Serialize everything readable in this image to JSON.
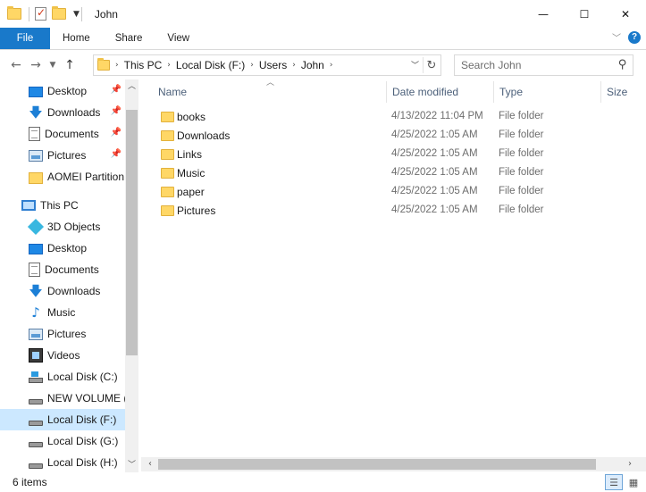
{
  "window": {
    "title": "John",
    "controls": {
      "minimize": "—",
      "maximize": "☐",
      "close": "✕"
    }
  },
  "ribbon": {
    "tabs": [
      {
        "label": "File",
        "active": true
      },
      {
        "label": "Home"
      },
      {
        "label": "Share"
      },
      {
        "label": "View"
      }
    ]
  },
  "address": {
    "crumbs": [
      "This PC",
      "Local Disk (F:)",
      "Users",
      "John"
    ]
  },
  "search": {
    "placeholder": "Search John"
  },
  "nav": {
    "items": [
      {
        "label": "Desktop",
        "icon": "desktop-icon",
        "pinned": true
      },
      {
        "label": "Downloads",
        "icon": "download-icon",
        "pinned": true
      },
      {
        "label": "Documents",
        "icon": "documents-icon",
        "pinned": true
      },
      {
        "label": "Pictures",
        "icon": "pictures-icon",
        "pinned": true
      },
      {
        "label": "AOMEI Partition",
        "icon": "folder-icon"
      },
      {
        "label": "This PC",
        "icon": "this-pc-icon"
      },
      {
        "label": "3D Objects",
        "icon": "3d-objects-icon"
      },
      {
        "label": "Desktop",
        "icon": "desktop-icon"
      },
      {
        "label": "Documents",
        "icon": "documents-icon"
      },
      {
        "label": "Downloads",
        "icon": "download-icon"
      },
      {
        "label": "Music",
        "icon": "music-icon"
      },
      {
        "label": "Pictures",
        "icon": "pictures-icon"
      },
      {
        "label": "Videos",
        "icon": "videos-icon"
      },
      {
        "label": "Local Disk (C:)",
        "icon": "drive-icon"
      },
      {
        "label": "NEW VOLUME (E",
        "icon": "drive-icon"
      },
      {
        "label": "Local Disk (F:)",
        "icon": "drive-icon",
        "selected": true
      },
      {
        "label": "Local Disk (G:)",
        "icon": "drive-icon"
      },
      {
        "label": "Local Disk (H:)",
        "icon": "drive-icon"
      }
    ]
  },
  "columns": {
    "name": "Name",
    "date": "Date modified",
    "type": "Type",
    "size": "Size"
  },
  "files": [
    {
      "name": "books",
      "date": "4/13/2022 11:04 PM",
      "type": "File folder"
    },
    {
      "name": "Downloads",
      "date": "4/25/2022 1:05 AM",
      "type": "File folder"
    },
    {
      "name": "Links",
      "date": "4/25/2022 1:05 AM",
      "type": "File folder"
    },
    {
      "name": "Music",
      "date": "4/25/2022 1:05 AM",
      "type": "File folder"
    },
    {
      "name": "paper",
      "date": "4/25/2022 1:05 AM",
      "type": "File folder"
    },
    {
      "name": "Pictures",
      "date": "4/25/2022 1:05 AM",
      "type": "File folder"
    }
  ],
  "status": {
    "item_count": "6 items"
  },
  "colors": {
    "accent": "#1979ca",
    "selection": "#cce8ff",
    "folder": "#ffd766"
  }
}
